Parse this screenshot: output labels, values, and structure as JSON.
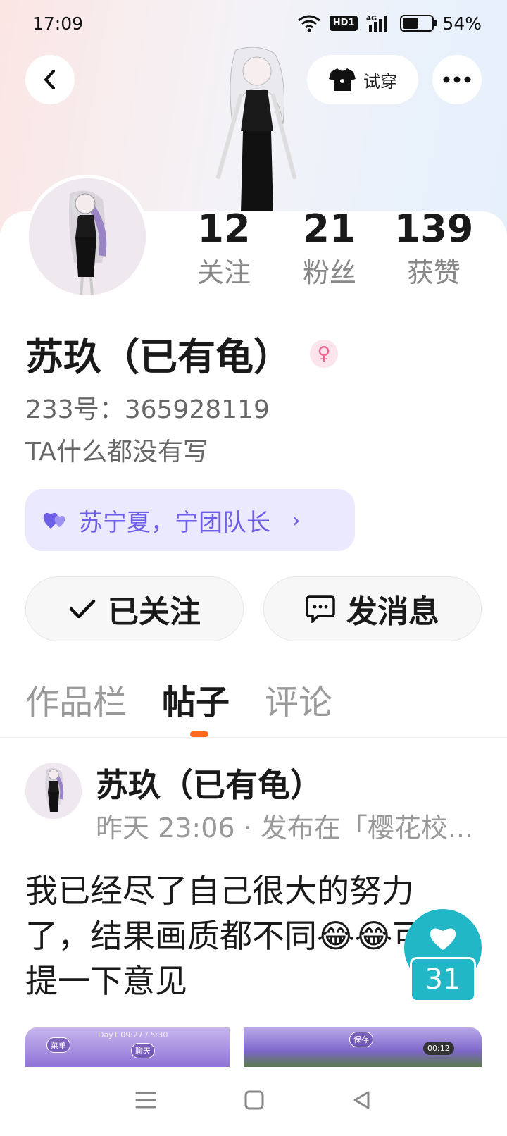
{
  "status_bar": {
    "time": "17:09",
    "network": "4G",
    "hd": "HD1",
    "battery_text": "54%",
    "battery_level": 0.54
  },
  "header": {
    "tryon_label": "试穿"
  },
  "stats": [
    {
      "count": "12",
      "label": "关注"
    },
    {
      "count": "21",
      "label": "粉丝"
    },
    {
      "count": "139",
      "label": "获赞"
    }
  ],
  "profile": {
    "name": "苏玖（已有龟）",
    "gender_symbol": "♀",
    "uid": "233号：365928119",
    "bio": "TA什么都没有写",
    "relation": "苏宁夏，宁团队长"
  },
  "actions": {
    "follow_label": "已关注",
    "message_label": "发消息"
  },
  "tabs": [
    {
      "label": "作品栏",
      "active": false
    },
    {
      "label": "帖子",
      "active": true
    },
    {
      "label": "评论",
      "active": false
    }
  ],
  "post": {
    "author": "苏玖（已有龟）",
    "meta": "昨天 23:06 · 发布在「樱花校...",
    "body": "我已经尽了自己很大的努力了，结果画质都不同😂😂可以提一下意见",
    "like_count": "31",
    "image_labels": [
      "Day1 09:27 / 5:30",
      "菜单",
      "聊天",
      "保存",
      "00:12"
    ]
  },
  "colors": {
    "accent_orange": "#ff6a1f",
    "relation_purple": "#6d5ee6",
    "like_teal": "#21b7c6",
    "gender_pink": "#f06292"
  }
}
